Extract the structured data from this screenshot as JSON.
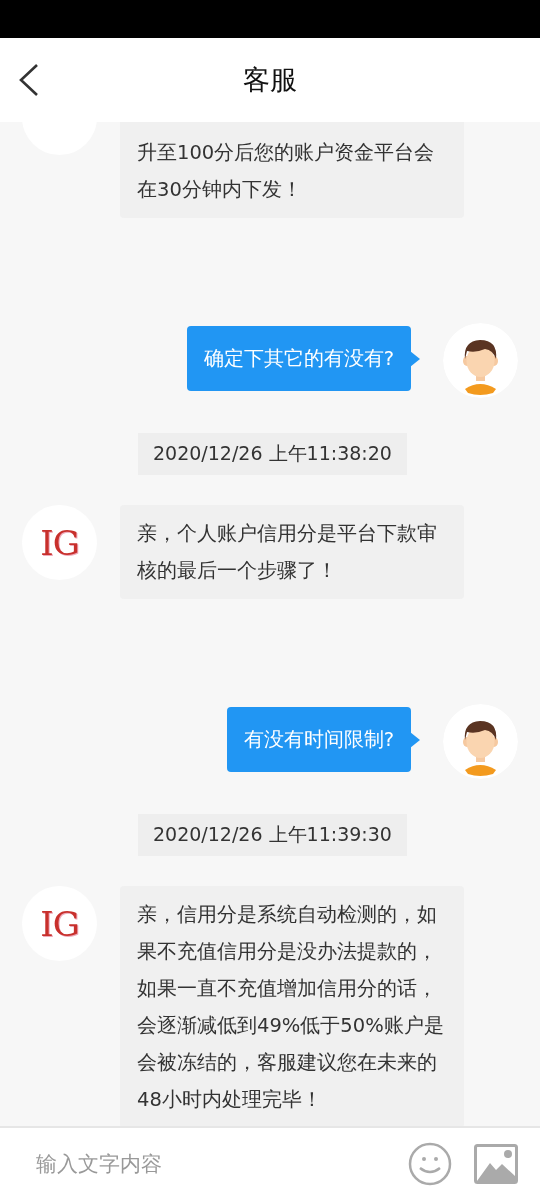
{
  "header": {
    "title": "客服"
  },
  "messages": [
    {
      "kind": "bot",
      "text": "升至100分后您的账户资金平台会在30分钟内下发！"
    },
    {
      "kind": "user",
      "text": "确定下其它的有没有?"
    },
    {
      "kind": "time",
      "text": "2020/12/26 上午11:38:20"
    },
    {
      "kind": "bot",
      "avatar_text": "IG",
      "text": "亲，个人账户信用分是平台下款审核的最后一个步骤了！"
    },
    {
      "kind": "user",
      "text": "有没有时间限制?"
    },
    {
      "kind": "time",
      "text": "2020/12/26 上午11:39:30"
    },
    {
      "kind": "bot",
      "avatar_text": "IG",
      "text": "亲，信用分是系统自动检测的，如果不充值信用分是没办法提款的，如果一直不充值增加信用分的话，会逐渐减低到49%低于50%账户是会被冻结的，客服建议您在未来的48小时内处理完毕！"
    }
  ],
  "input": {
    "placeholder": "输入文字内容"
  }
}
